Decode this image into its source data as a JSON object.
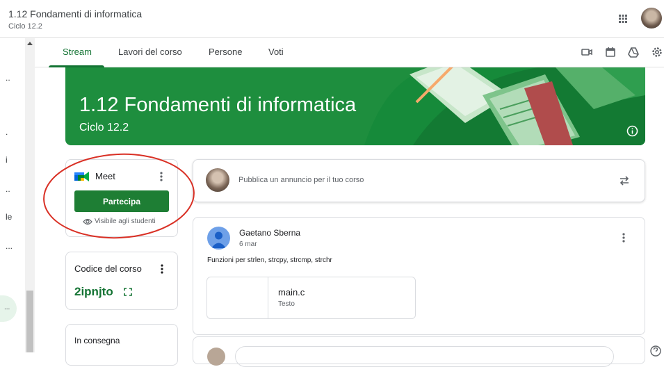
{
  "header": {
    "course_title": "1.12 Fondamenti di informatica",
    "course_sub": "Ciclo 12.2"
  },
  "left_nav": {
    "items": [
      "..",
      ".",
      "i",
      "..",
      "le",
      "..."
    ],
    "bubble": "..."
  },
  "tabs": [
    {
      "label": "Stream",
      "active": true
    },
    {
      "label": "Lavori del corso"
    },
    {
      "label": "Persone"
    },
    {
      "label": "Voti"
    }
  ],
  "banner": {
    "title": "1.12 Fondamenti di informatica",
    "subtitle": "Ciclo 12.2",
    "color": "#1e8e3e"
  },
  "meet": {
    "title": "Meet",
    "join_label": "Partecipa",
    "visibility": "Visibile agli studenti"
  },
  "course_code": {
    "label": "Codice del corso",
    "value": "2ipnjto"
  },
  "pending": {
    "label": "In consegna"
  },
  "announce": {
    "placeholder": "Pubblica un annuncio per il tuo corso"
  },
  "post": {
    "author": "Gaetano Sberna",
    "date": "6 mar",
    "text": "Funzioni per strlen, strcpy, strcmp, strchr",
    "attachment": {
      "name": "main.c",
      "type": "Testo"
    }
  },
  "colors": {
    "accent": "#137333",
    "annotation": "#d93025"
  }
}
